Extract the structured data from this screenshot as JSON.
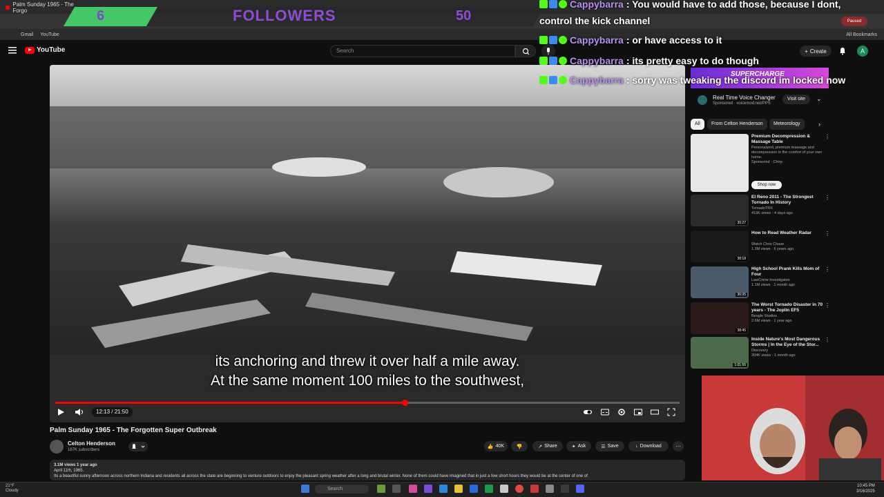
{
  "browser": {
    "tab_title": "Palm Sunday 1965 - The Forgo",
    "bookmarks": [
      "Gmail",
      "YouTube"
    ],
    "profile_status": "Paused",
    "all_bookmarks": "All Bookmarks"
  },
  "overlay": {
    "follower_count": "6",
    "followers_label": "FOLLOWERS",
    "follower_goal": "50"
  },
  "chat": [
    {
      "user": "Cappybarra",
      "message": ": You would have to add those, because I dont,"
    },
    {
      "user": "",
      "message": "control the kick channel"
    },
    {
      "user": "Cappybarra",
      "message": ": or have access to it"
    },
    {
      "user": "Cappybarra",
      "message": ": its pretty easy to do though"
    },
    {
      "user": "Cappybarra",
      "message": ": sorry was tweaking the discord im locked now"
    }
  ],
  "youtube": {
    "logo": "YouTube",
    "search_placeholder": "Search",
    "create_label": "Create",
    "avatar_letter": "A"
  },
  "player": {
    "subtitle_line1": "its anchoring and threw it over half a mile away.",
    "subtitle_line2": "At the same moment 100 miles to the southwest,",
    "time": "12:13 / 21:50",
    "progress": 0.5595
  },
  "video": {
    "title": "Palm Sunday 1965 - The Forgotten Super Outbreak",
    "channel": "Celton Henderson",
    "subscribers": "167K subscribers",
    "likes": "40K",
    "share": "Share",
    "ask": "Ask",
    "save": "Save",
    "download": "Download",
    "views_date": "3.1M views  1 year ago",
    "desc_date": "April 11th, 1965.",
    "description": "Its a beautiful sunny afternoon across northern Indiana and residents all across the state are beginning to venture outdoors to enjoy the pleasant spring weather after a long and brutal winter. None of them could have imagined that in just a few short hours they would be at the center of one of"
  },
  "sidebar": {
    "ad_banner": "SUPERCHARGE",
    "ad_title": "Real Time Voice Changer",
    "ad_sponsor": "Sponsored · voicemod.net/PPS",
    "visit_site": "Visit site",
    "chips": [
      "All",
      "From Celton Henderson",
      "Meteorology"
    ],
    "recommendations": [
      {
        "title": "Premium Decompression & Massage Table",
        "meta": "Personalized, premium massage and decompression in the comfort of your own home.",
        "channel": "Sponsored · Chirp",
        "cta": "Shop now",
        "duration": ""
      },
      {
        "title": "El Reno 2011 - The Strongest Tornado In History",
        "meta": "416K views · 4 days ago",
        "channel": "TornadoTRX",
        "cta": "",
        "duration": "30:27"
      },
      {
        "title": "How to Read Weather Radar",
        "meta": "1.3M views · 6 years ago",
        "channel": "Watch Chris Chase",
        "cta": "",
        "duration": "38:18"
      },
      {
        "title": "High School Prank Kills Mom of Four",
        "meta": "1.1M views · 1 month ago",
        "channel": "LawCrime Investigates",
        "cta": "",
        "duration": "36:05"
      },
      {
        "title": "The Worst Tornado Disaster in 70 years - The Joplin EF5",
        "meta": "2.6M views · 1 year ago",
        "channel": "Beagle Studios",
        "cta": "",
        "duration": "38:45"
      },
      {
        "title": "Inside Nature's Most Dangerous Storms | In the Eye of the Stor...",
        "meta": "304K views · 1 month ago",
        "channel": "Discovery",
        "cta": "",
        "duration": "1:01:56"
      }
    ]
  },
  "taskbar": {
    "weather_temp": "21°F",
    "weather_text": "Cloudy",
    "search": "Search",
    "time": "10:45 PM",
    "date": "3/16/2025"
  },
  "colors": {
    "accent_red": "#ff0000",
    "followers_purple": "#8e4bd8",
    "chat_user": "#b68ff0",
    "kick_green": "#53fc18"
  }
}
